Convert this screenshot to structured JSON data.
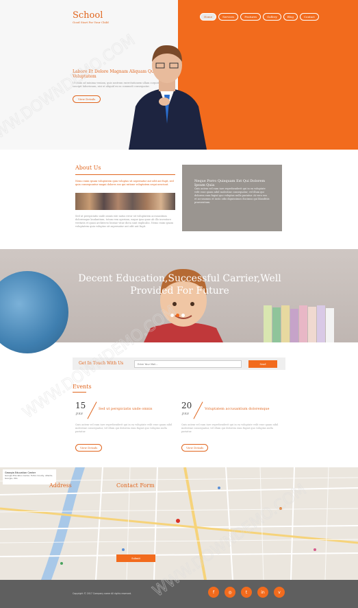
{
  "header": {
    "brand": "School",
    "brand_sub": "Good Start For Your Child",
    "nav": [
      "Home",
      "Services",
      "Features",
      "Gallery",
      "Blog",
      "Contact"
    ]
  },
  "hero": {
    "title": "Labore Et Dolore Magnam Aliquam Quaerat Voluptatem",
    "text": "Ut enim ad minima veniam, quis nostrum exercitationem ullam corporis suscipit laboriosam, nisi ut aliquid ex ea commodi consequatur.",
    "button": "View Details"
  },
  "about": {
    "title": "About Us",
    "lead": "Nemo enim ipsam voluptatem quia voluptas sit aspernatur aut odit aut fugit, sed quia consequuntur magni dolores eos qui ratione voluptatem sequi nesciunt.",
    "text": "Sed ut perspiciatis unde omnis iste natus error sit voluptatem accusantium doloremque laudantium, totam rem aperiam, eaque ipsa quae ab illo inventore veritatis et quasi architecto beatae vitae dicta sunt explicabo. Nemo enim ipsam voluptatem quia voluptas sit aspernatur aut odit aut fugit.",
    "card_title": "Neque Porro Quisquam Est Qui Dolorem Ipsum Quia",
    "card_text": "Quis autem vel eum iure reprehenderit qui in ea voluptate velit esse quam nihil molestiae consequatur, vel illum qui dolorem eum fugiat quo voluptas nulla pariatur. At vero eos et accusamus et iusto odio dignissimos ducimus qui blanditiis praesentium."
  },
  "banner": {
    "title": "Decent Education,Successful Carrier,Well Provided For Future"
  },
  "touch": {
    "label": "Get In Touch With Us",
    "placeholder": "Enter Your Mail...",
    "button": "Send"
  },
  "events": {
    "title": "Events",
    "items": [
      {
        "day": "15",
        "month": "JULY",
        "title": "Sed ut perspiciatis unde omnis",
        "text": "Quis autem vel eum iure reprehenderit qui in ea voluptate velit esse quam nihil molestiae consequatur, vel illum qui dolorem eum fugiat quo voluptas nulla pariatur.",
        "button": "View Details"
      },
      {
        "day": "20",
        "month": "JULY",
        "title": "Voluptatem accusantium doloremque",
        "text": "Quis autem vel eum iure reprehenderit qui in ea voluptate velit esse quam nihil molestiae consequatur, vel illum qui dolorem eum fugiat quo voluptas nulla pariatur.",
        "button": "View Details"
      }
    ]
  },
  "map": {
    "card_title": "Georgia Education Center",
    "card_address": "Georgia Education Center, Fulton County, Atlanta, Georgia, USA",
    "address_title": "Address",
    "contact_title": "Contact Form",
    "submit": "Submit"
  },
  "footer": {
    "copyright": "Copyright © 2017 Company name All rights reserved."
  },
  "watermark": "WWW.DOWNDEMO.COM",
  "colors": {
    "accent": "#f26b1d",
    "footer": "#5f5f5f"
  }
}
